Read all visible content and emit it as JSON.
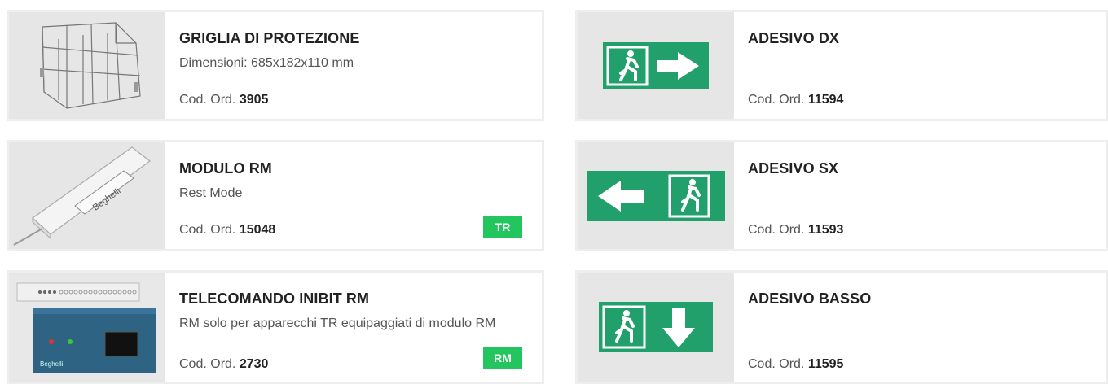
{
  "left": [
    {
      "title": "GRIGLIA DI PROTEZIONE",
      "desc": "Dimensioni: 685x182x110 mm",
      "code_prefix": "Cod. Ord.",
      "code": "3905",
      "badge": ""
    },
    {
      "title": "MODULO RM",
      "desc": "Rest Mode",
      "code_prefix": "Cod. Ord.",
      "code": "15048",
      "badge": "TR",
      "image_text": "Beghelli"
    },
    {
      "title": "TELECOMANDO INIBIT RM",
      "desc": "RM solo per apparecchi TR equipaggiati di modulo RM",
      "code_prefix": "Cod. Ord.",
      "code": "2730",
      "badge": "RM",
      "image_text": "Beghelli"
    }
  ],
  "right": [
    {
      "title": "ADESIVO DX",
      "desc": "",
      "code_prefix": "Cod. Ord.",
      "code": "11594"
    },
    {
      "title": "ADESIVO SX",
      "desc": "",
      "code_prefix": "Cod. Ord.",
      "code": "11593"
    },
    {
      "title": "ADESIVO BASSO",
      "desc": "",
      "code_prefix": "Cod. Ord.",
      "code": "11595"
    }
  ],
  "colors": {
    "badge": "#22c55e",
    "sign_green": "#22a06b",
    "card_border": "#eeeeee",
    "thumb_bg": "#e6e6e6"
  }
}
